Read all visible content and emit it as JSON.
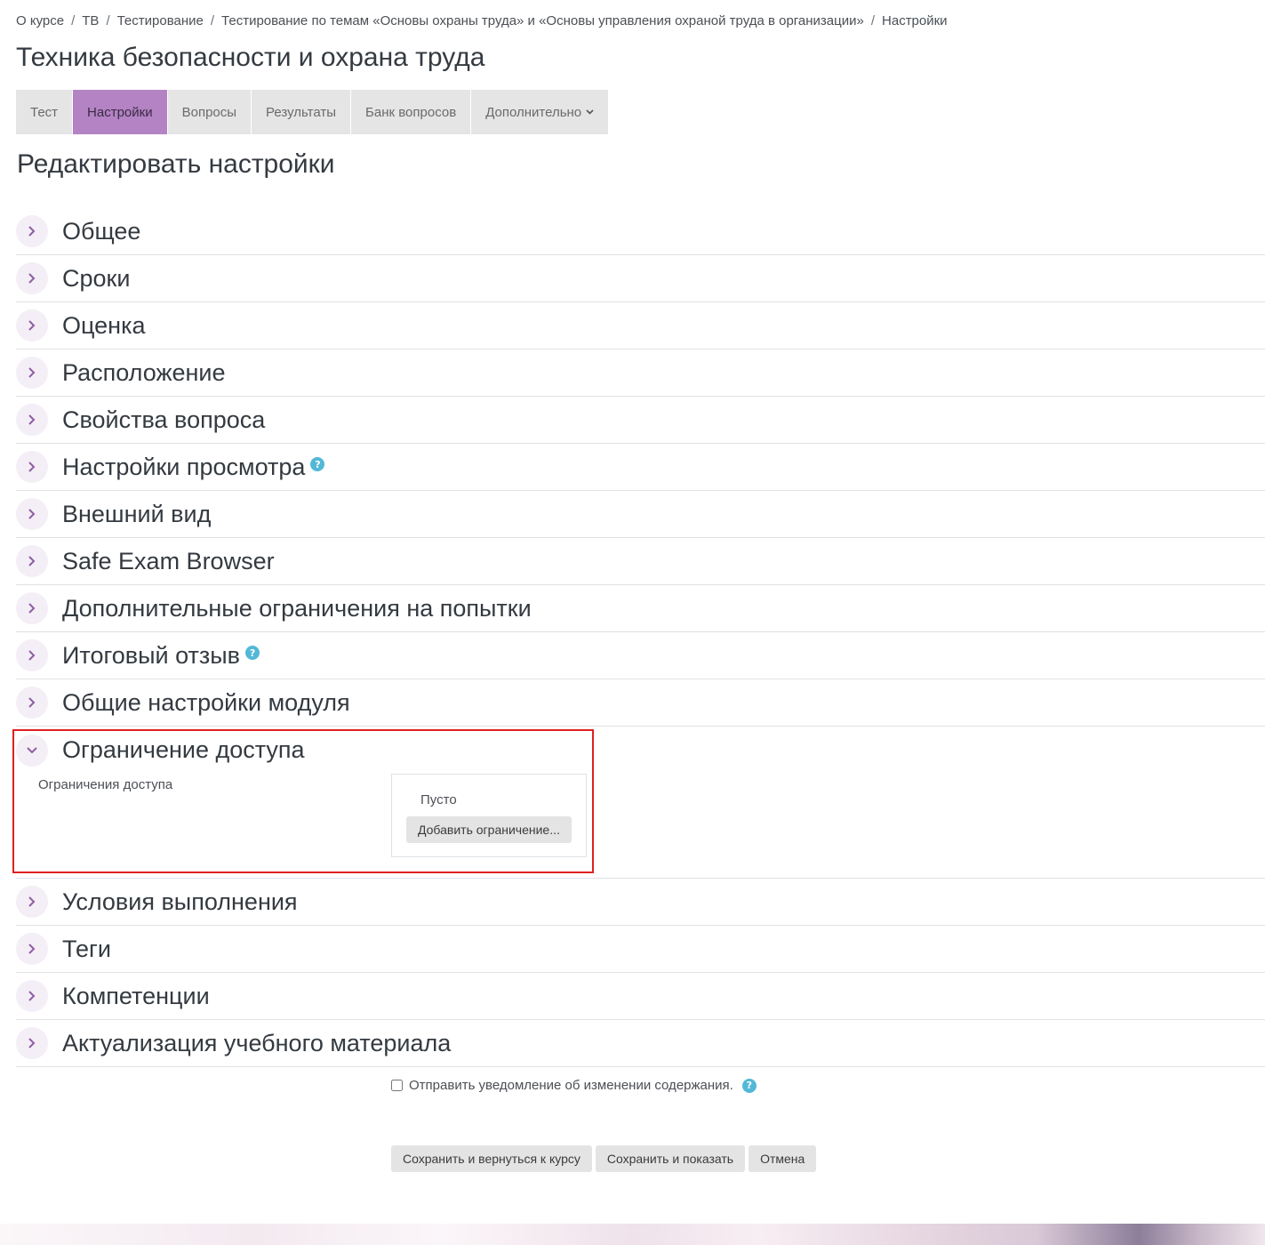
{
  "breadcrumb": {
    "items": [
      "О курсе",
      "ТВ",
      "Тестирование",
      "Тестирование по темам «Основы охраны труда» и «Основы управления охраной труда в организации»"
    ],
    "current": "Настройки",
    "separator": "/"
  },
  "course_title": "Техника безопасности и охрана труда",
  "tabs": [
    {
      "label": "Тест"
    },
    {
      "label": "Настройки",
      "active": true
    },
    {
      "label": "Вопросы"
    },
    {
      "label": "Результаты"
    },
    {
      "label": "Банк вопросов"
    },
    {
      "label": "Дополнительно"
    }
  ],
  "page_heading": "Редактировать настройки",
  "sections_before": [
    {
      "title": "Общее"
    },
    {
      "title": "Сроки"
    },
    {
      "title": "Оценка"
    },
    {
      "title": "Расположение"
    },
    {
      "title": "Свойства вопроса"
    },
    {
      "title": "Настройки просмотра",
      "help": true
    },
    {
      "title": "Внешний вид"
    },
    {
      "title": "Safe Exam Browser"
    },
    {
      "title": "Дополнительные ограничения на попытки"
    },
    {
      "title": "Итоговый отзыв",
      "help": true
    },
    {
      "title": "Общие настройки модуля"
    }
  ],
  "access_section": {
    "title": "Ограничение доступа",
    "field_label": "Ограничения доступа",
    "empty_text": "Пусто",
    "add_button": "Добавить ограничение..."
  },
  "sections_after": [
    {
      "title": "Условия выполнения"
    },
    {
      "title": "Теги"
    },
    {
      "title": "Компетенции"
    },
    {
      "title": "Актуализация учебного материала"
    }
  ],
  "notify": {
    "label": "Отправить уведомление об изменении содержания.",
    "checked": false
  },
  "buttons": {
    "save_return": "Сохранить и вернуться к курсу",
    "save_display": "Сохранить и показать",
    "cancel": "Отмена"
  },
  "colors": {
    "accent": "#b383c4",
    "help_icon": "#53b8d7",
    "highlight": "#e02020"
  },
  "icons": {
    "collapsed": "chevron-right-icon",
    "expanded": "chevron-down-icon",
    "help": "question-circle-icon"
  }
}
